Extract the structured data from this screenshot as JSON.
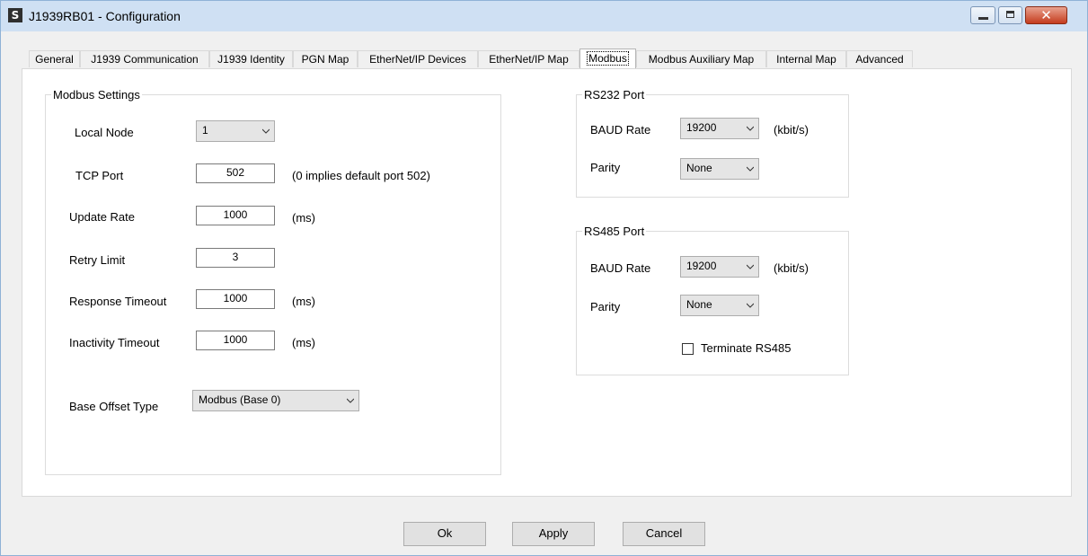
{
  "window": {
    "icon_glyph": "S",
    "icon_name": "app-logo-icon",
    "title": "J1939RB01 - Configuration",
    "controls": {
      "minimize_icon": "minimize-icon",
      "maximize_icon": "maximize-icon",
      "close_glyph": "✕"
    }
  },
  "tabs": [
    {
      "label": "General"
    },
    {
      "label": "J1939 Communication"
    },
    {
      "label": "J1939 Identity"
    },
    {
      "label": "PGN Map"
    },
    {
      "label": "EtherNet/IP Devices"
    },
    {
      "label": "EtherNet/IP Map"
    },
    {
      "label": "Modbus",
      "active": true
    },
    {
      "label": "Modbus Auxiliary Map"
    },
    {
      "label": "Internal Map"
    },
    {
      "label": "Advanced"
    }
  ],
  "modbus_settings": {
    "title": "Modbus Settings",
    "local_node": {
      "label": "Local Node",
      "value": "1"
    },
    "tcp_port": {
      "label": "TCP Port",
      "value": "502",
      "note": "(0 implies default port 502)"
    },
    "update_rate": {
      "label": "Update Rate",
      "value": "1000",
      "unit": "(ms)"
    },
    "retry_limit": {
      "label": "Retry Limit",
      "value": "3"
    },
    "response_timeout": {
      "label": "Response Timeout",
      "value": "1000",
      "unit": "(ms)"
    },
    "inactivity_timeout": {
      "label": "Inactivity Timeout",
      "value": "1000",
      "unit": "(ms)"
    },
    "base_offset_type": {
      "label": "Base Offset Type",
      "value": "Modbus (Base 0)"
    }
  },
  "rs232": {
    "title": "RS232 Port",
    "baud_label": "BAUD Rate",
    "baud_value": "19200",
    "baud_unit": "(kbit/s)",
    "parity_label": "Parity",
    "parity_value": "None"
  },
  "rs485": {
    "title": "RS485 Port",
    "baud_label": "BAUD Rate",
    "baud_value": "19200",
    "baud_unit": "(kbit/s)",
    "parity_label": "Parity",
    "parity_value": "None",
    "terminate_label": "Terminate RS485",
    "terminate_checked": false
  },
  "buttons": {
    "ok": "Ok",
    "apply": "Apply",
    "cancel": "Cancel"
  }
}
